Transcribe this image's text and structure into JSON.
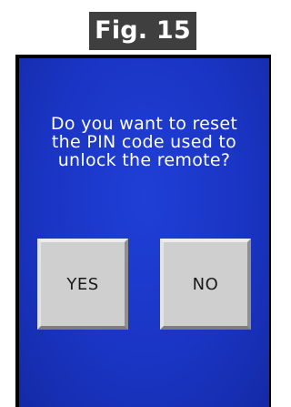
{
  "figure": {
    "label": "Fig. 15"
  },
  "dialog": {
    "prompt_lines": [
      "Do you want to reset",
      "the PIN code used to",
      "unlock the remote?"
    ],
    "yes_label": "YES",
    "no_label": "NO"
  },
  "colors": {
    "screen_background": "#1a35c4",
    "button_face": "#cfcfcf",
    "figure_label_background": "#3f3f3f",
    "text_on_screen": "#ffffff"
  }
}
